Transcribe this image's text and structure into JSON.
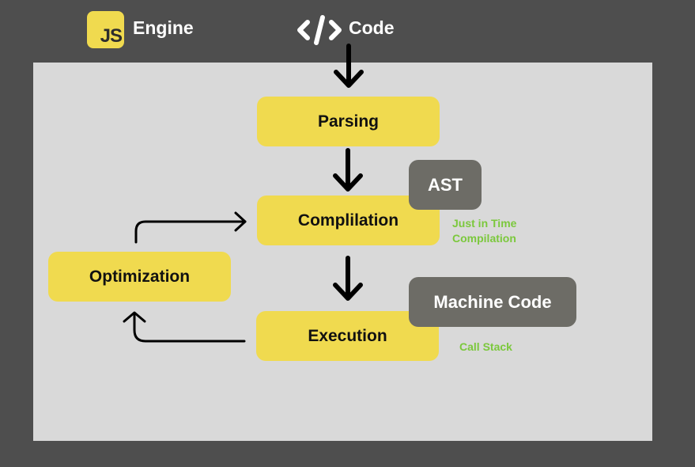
{
  "header": {
    "logo_text": "JS",
    "engine_label": "Engine",
    "code_label": "Code"
  },
  "diagram": {
    "steps": {
      "parsing": "Parsing",
      "compilation": "Complilation",
      "execution": "Execution",
      "optimization": "Optimization"
    },
    "outputs": {
      "ast": "AST",
      "machine_code": "Machine Code"
    },
    "notes": {
      "jit_line1": "Just in Time",
      "jit_line2": "Compilation",
      "call_stack": "Call Stack"
    },
    "colors": {
      "background": "#4e4e4e",
      "panel": "#d9d9d9",
      "step": "#f0da4f",
      "output": "#6d6c66",
      "note": "#7bc83c"
    }
  }
}
